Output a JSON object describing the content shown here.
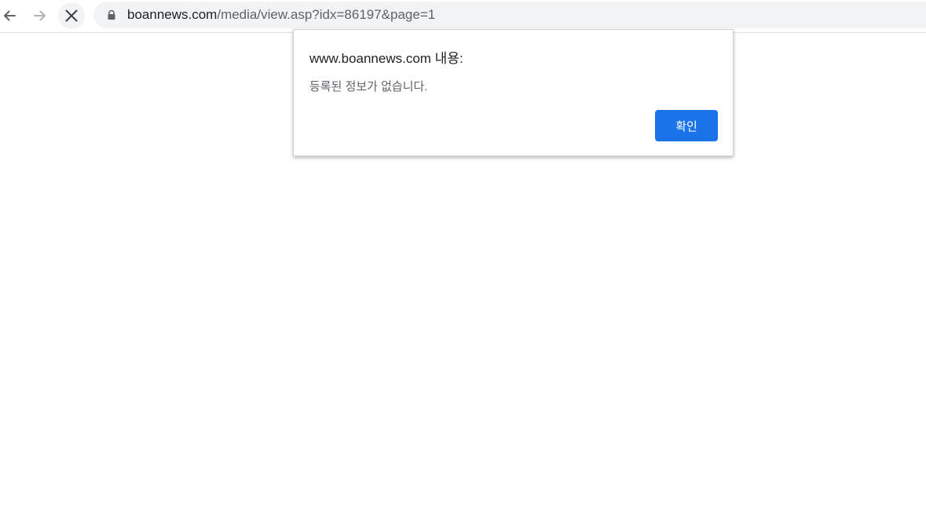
{
  "browser": {
    "url_host": "boannews.com",
    "url_path": "/media/view.asp?idx=86197&page=1",
    "icons": {
      "back": "arrow-left-icon",
      "forward": "arrow-right-icon",
      "stop": "close-icon",
      "secure": "lock-icon"
    }
  },
  "dialog": {
    "title": "www.boannews.com 내용:",
    "message": "등록된 정보가 없습니다.",
    "ok_label": "확인",
    "accent_color": "#1a73e8"
  }
}
